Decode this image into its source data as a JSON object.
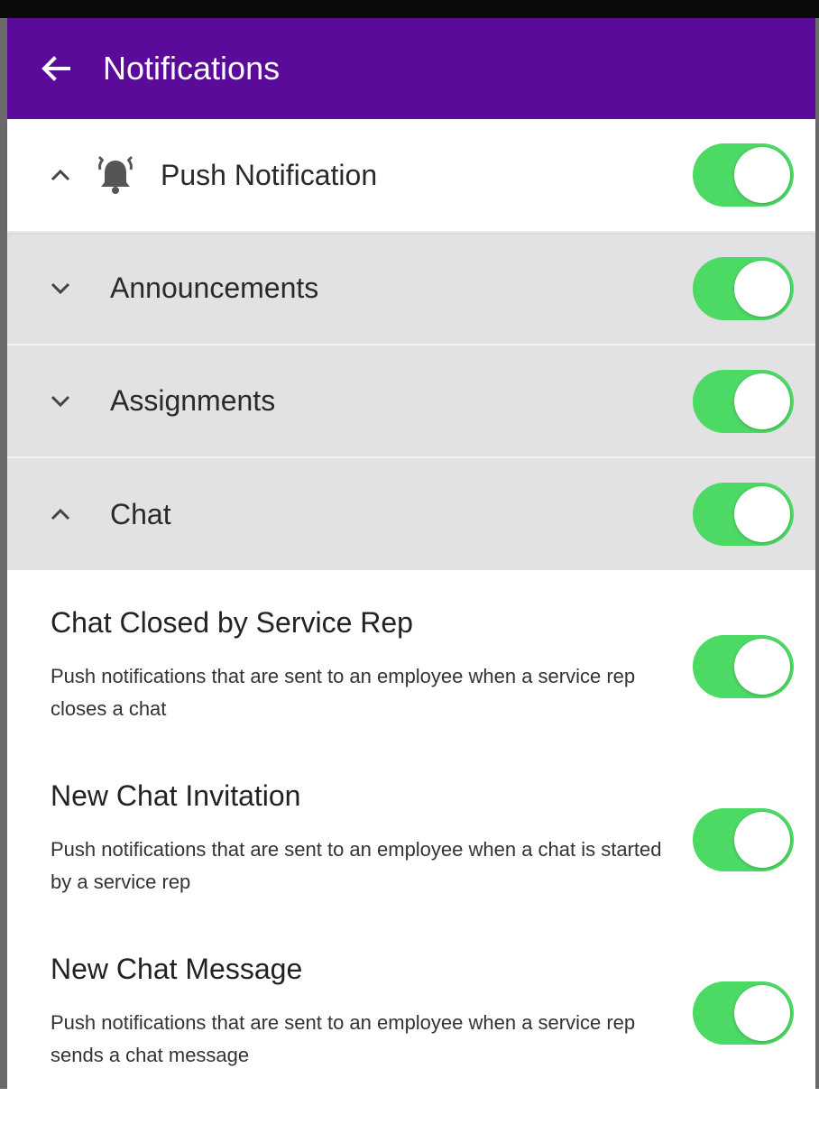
{
  "appbar": {
    "title": "Notifications",
    "back_icon": "arrow-left-icon",
    "color": "#5a0b9a"
  },
  "push": {
    "label": "Push Notification",
    "icon": "bell-ringing-icon",
    "enabled": true,
    "expanded": true
  },
  "sections": [
    {
      "label": "Announcements",
      "enabled": true,
      "expanded": false
    },
    {
      "label": "Assignments",
      "enabled": true,
      "expanded": false
    },
    {
      "label": "Chat",
      "enabled": true,
      "expanded": true
    }
  ],
  "chat_items": [
    {
      "title": "Chat Closed by Service Rep",
      "description": "Push notifications that are sent to an employee when a service rep closes a chat",
      "enabled": true
    },
    {
      "title": "New Chat Invitation",
      "description": "Push notifications that are sent to an employee when a chat is started by a service rep",
      "enabled": true
    },
    {
      "title": "New Chat Message",
      "description": "Push notifications that are sent to an employee when a service rep sends a chat message",
      "enabled": true
    }
  ],
  "colors": {
    "toggle_on": "#4cd964",
    "section_bg": "#e2e1e4"
  }
}
